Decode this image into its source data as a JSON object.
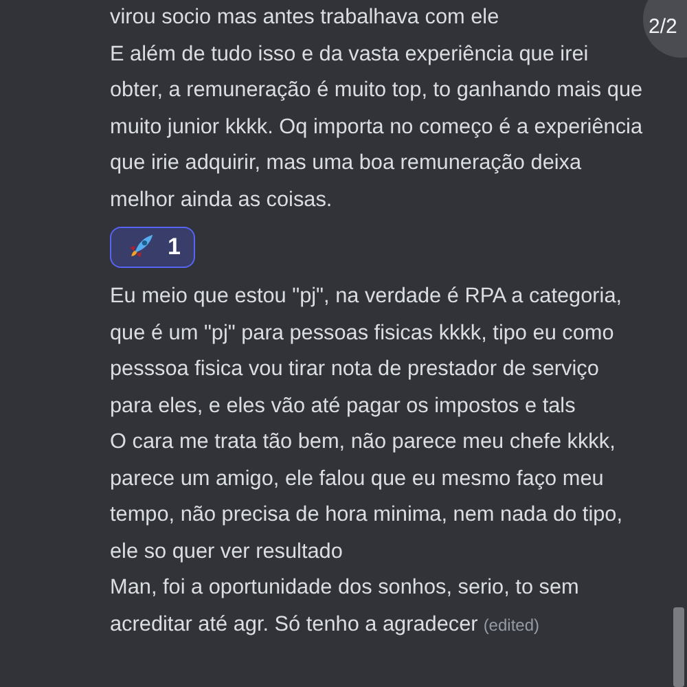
{
  "pager": {
    "label": "2/2"
  },
  "items": [
    {
      "kind": "message",
      "text": "virou socio mas antes trabalhava com ele",
      "edited": false
    },
    {
      "kind": "message",
      "text": "E além de tudo isso e da vasta experiência que irei obter, a remuneração é muito top, to ganhando mais que muito junior kkkk. Oq importa no começo é a experiência que irie adquirir, mas uma boa remuneração deixa melhor ainda as coisas.",
      "edited": false
    },
    {
      "kind": "reaction",
      "count": "1",
      "selected": true
    },
    {
      "kind": "message",
      "text": "Eu meio que estou \"pj\", na verdade é RPA a categoria, que é um \"pj\" para pessoas fisicas kkkk, tipo eu como pesssoa fisica vou tirar nota de prestador de serviço para eles, e eles vão até pagar os impostos e tals",
      "edited": false
    },
    {
      "kind": "message",
      "text": "O cara me trata tão bem, não parece meu chefe kkkk, parece um amigo, ele falou que eu mesmo faço meu tempo, não precisa de hora minima, nem nada do tipo, ele so quer ver resultado",
      "edited": false
    },
    {
      "kind": "message",
      "text": "Man, foi a oportunidade dos sonhos, serio, to sem acreditar até agr. Só tenho a agradecer",
      "edited": true,
      "edited_label": "(edited)"
    }
  ]
}
